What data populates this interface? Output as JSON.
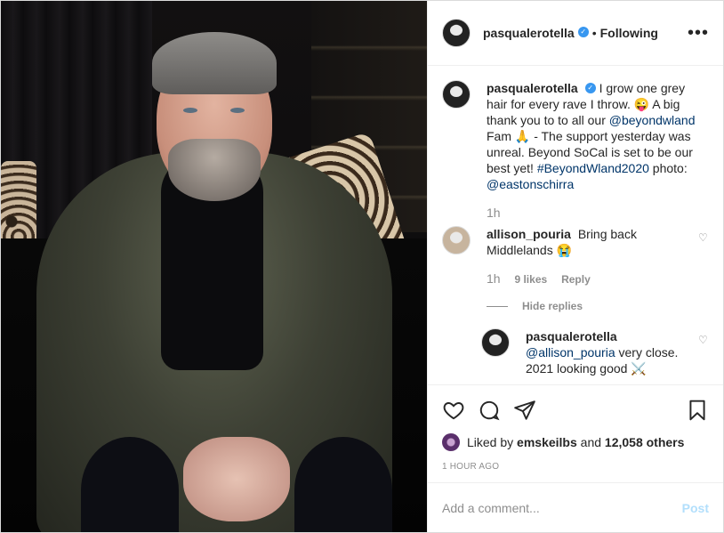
{
  "post": {
    "author": "pasqualerotella",
    "follow_state": "Following",
    "more_icon": "more-horizontal-icon"
  },
  "caption": {
    "author": "pasqualerotella",
    "text_1": "I grow one grey hair for every rave I throw. 😜 A big thank you to to all our ",
    "mention_1": "@beyondwland",
    "text_2": " Fam 🙏 - The support yesterday was unreal. Beyond SoCal is set to be our best yet! ",
    "hashtag": "#BeyondWland2020",
    "text_3": " photo: ",
    "mention_2": "@eastonschirra",
    "time": "1h"
  },
  "comment": {
    "author": "allison_pouria",
    "text": "Bring back Middlelands 😭",
    "time": "1h",
    "likes": "9 likes",
    "reply_label": "Reply",
    "hide_replies": "Hide replies"
  },
  "reply": {
    "author": "pasqualerotella",
    "mention": "@allison_pouria",
    "text": " very close. 2021 looking good ⚔️"
  },
  "actions": {
    "liked_by_prefix": "Liked by ",
    "liked_by_user": "emskeilbs",
    "liked_by_and": " and ",
    "liked_by_count": "12,058 others",
    "time_ago": "1 HOUR AGO"
  },
  "composer": {
    "placeholder": "Add a comment...",
    "post_label": "Post"
  },
  "colors": {
    "verified": "#3897f0",
    "link": "#003569",
    "post_disabled": "#b2dffc"
  }
}
